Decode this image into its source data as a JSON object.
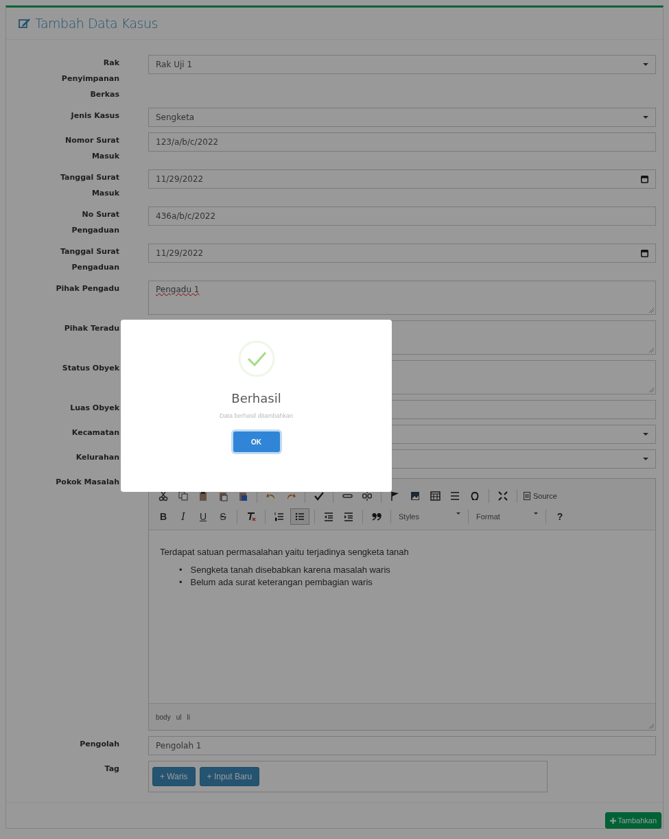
{
  "panel": {
    "title": "Tambah Data Kasus",
    "fields": [
      {
        "label": "Rak Penyimpanan Berkas",
        "kind": "select",
        "value": "Rak Uji 1"
      },
      {
        "label": "Jenis Kasus",
        "kind": "select",
        "value": "Sengketa"
      },
      {
        "label": "Nomor Surat Masuk",
        "kind": "text",
        "value": "123/a/b/c/2022"
      },
      {
        "label": "Tanggal Surat Masuk",
        "kind": "date",
        "value": "11/29/2022"
      },
      {
        "label": "No Surat Pengaduan",
        "kind": "text",
        "value": "436a/b/c/2022"
      },
      {
        "label": "Tanggal Surat Pengaduan",
        "kind": "date",
        "value": "11/29/2022"
      },
      {
        "label": "Pihak Pengadu",
        "kind": "textarea",
        "value": "Pengadu 1",
        "spelling_error": true
      },
      {
        "label": "Pihak Teradu",
        "kind": "textarea"
      },
      {
        "label": "Status Obyek",
        "kind": "textarea"
      },
      {
        "label": "Luas Obyek",
        "kind": "text"
      },
      {
        "label": "Kecamatan",
        "kind": "select"
      },
      {
        "label": "Kelurahan",
        "kind": "select"
      },
      {
        "label": "Pokok Masalah",
        "kind": "editor"
      },
      {
        "label": "Pengolah",
        "kind": "text",
        "value": "Pengolah 1"
      },
      {
        "label": "Tag",
        "kind": "tags"
      }
    ],
    "editor": {
      "source": "Source",
      "bold": "B",
      "italic": "I",
      "underline": "U",
      "strike": "S",
      "bulleted_list_on": true,
      "styles": "Styles",
      "format": "Format",
      "help": "?",
      "paragraph": "Terdapat satuan permasalahan yaitu terjadinya sengketa tanah",
      "bullets": [
        {
          "marker": "•",
          "text": "Sengketa tanah disebabkan karena masalah waris"
        },
        {
          "marker": "•",
          "text": "Belum ada surat keterangan pembagian waris"
        }
      ],
      "path": [
        "body",
        "ul",
        "li"
      ]
    },
    "tag_buttons": [
      "+ Waris",
      "+ Input Baru"
    ],
    "submit": "Tambahkan"
  },
  "modal": {
    "title": "Berhasil",
    "message": "Data berhasil ditambahkan",
    "button": "OK"
  }
}
